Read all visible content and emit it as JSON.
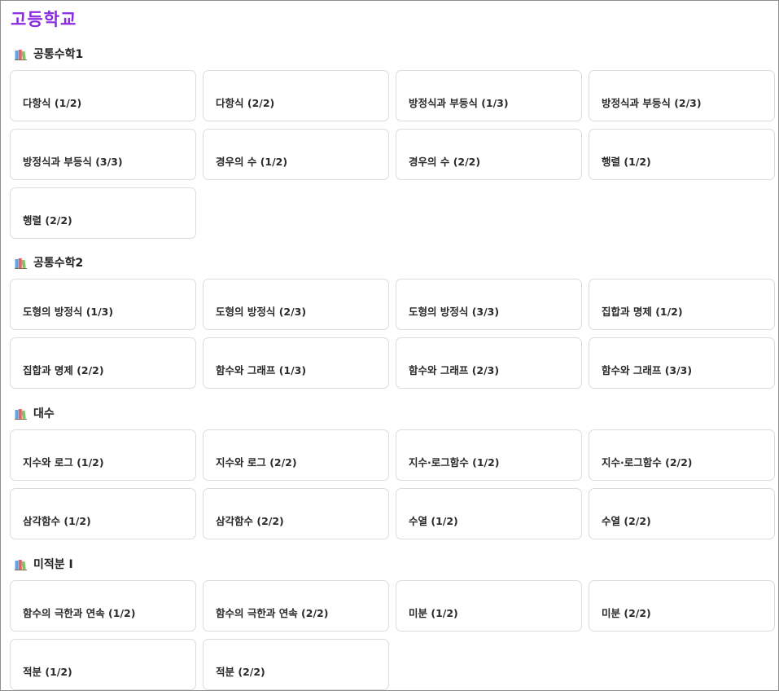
{
  "page": {
    "title": "고등학교"
  },
  "sections": [
    {
      "title": "공통수학1",
      "icon": "books-icon",
      "cards": [
        "다항식 (1/2)",
        "다항식 (2/2)",
        "방정식과 부등식 (1/3)",
        "방정식과 부등식 (2/3)",
        "방정식과 부등식 (3/3)",
        "경우의 수 (1/2)",
        "경우의 수 (2/2)",
        "행렬 (1/2)",
        "행렬 (2/2)"
      ]
    },
    {
      "title": "공통수학2",
      "icon": "books-icon",
      "cards": [
        "도형의 방정식 (1/3)",
        "도형의 방정식 (2/3)",
        "도형의 방정식 (3/3)",
        "집합과 명제 (1/2)",
        "집합과 명제 (2/2)",
        "함수와 그래프 (1/3)",
        "함수와 그래프 (2/3)",
        "함수와 그래프 (3/3)"
      ]
    },
    {
      "title": "대수",
      "icon": "books-icon",
      "cards": [
        "지수와 로그 (1/2)",
        "지수와 로그 (2/2)",
        "지수·로그함수 (1/2)",
        "지수·로그함수 (2/2)",
        "삼각함수 (1/2)",
        "삼각함수 (2/2)",
        "수열 (1/2)",
        "수열 (2/2)"
      ]
    },
    {
      "title": "미적분 I",
      "icon": "books-icon",
      "cards": [
        "함수의 극한과 연속 (1/2)",
        "함수의 극한과 연속 (2/2)",
        "미분 (1/2)",
        "미분 (2/2)",
        "적분 (1/2)",
        "적분 (2/2)"
      ]
    }
  ]
}
